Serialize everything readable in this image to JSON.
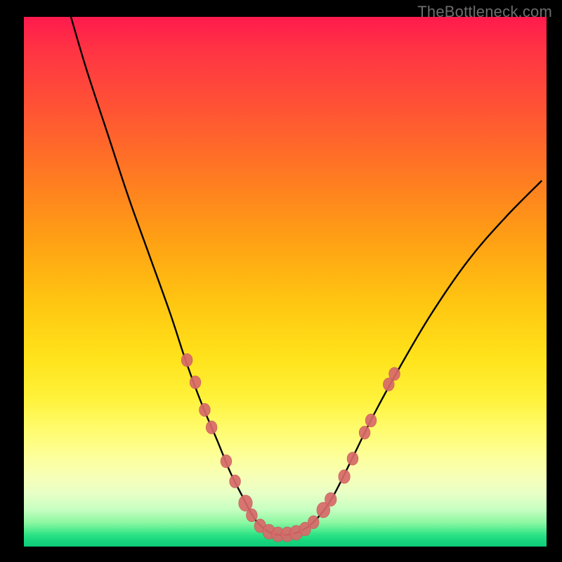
{
  "watermark": "TheBottleneck.com",
  "colors": {
    "frame": "#000000",
    "curve": "#000000",
    "marker_fill": "#d86a6a",
    "marker_stroke": "#c85a5a"
  },
  "chart_data": {
    "type": "line",
    "title": "",
    "xlabel": "",
    "ylabel": "",
    "xlim": [
      0,
      100
    ],
    "ylim": [
      0,
      100
    ],
    "grid": false,
    "legend": false,
    "note": "Bottleneck-style V curve. Axes are unlabeled; values are estimated positions in percent of plot area (0,0 = bottom-left).",
    "series": [
      {
        "name": "bottleneck-curve",
        "x": [
          9,
          12,
          16,
          20,
          24,
          28,
          31,
          34,
          37,
          39.5,
          41.8,
          43.5,
          45,
          47,
          49,
          51,
          53.5,
          56,
          58.5,
          60.5,
          63,
          67,
          72,
          78,
          85,
          92,
          99
        ],
        "y": [
          100,
          90,
          78,
          66,
          55,
          44,
          35,
          27,
          20,
          14,
          9.5,
          6.3,
          4.2,
          2.7,
          2.2,
          2.3,
          3.2,
          5.2,
          8.4,
          12,
          17,
          25,
          34,
          44,
          54,
          62,
          69
        ]
      }
    ],
    "markers": [
      {
        "x": 31.2,
        "y": 35.2,
        "r": 1.05
      },
      {
        "x": 32.8,
        "y": 31.0,
        "r": 1.05
      },
      {
        "x": 34.6,
        "y": 25.8,
        "r": 1.05
      },
      {
        "x": 35.9,
        "y": 22.5,
        "r": 1.05
      },
      {
        "x": 38.7,
        "y": 16.1,
        "r": 1.05
      },
      {
        "x": 40.4,
        "y": 12.3,
        "r": 1.05
      },
      {
        "x": 42.4,
        "y": 8.2,
        "r": 1.3
      },
      {
        "x": 43.6,
        "y": 5.9,
        "r": 1.05
      },
      {
        "x": 45.2,
        "y": 3.9,
        "r": 1.1
      },
      {
        "x": 46.9,
        "y": 2.8,
        "r": 1.2
      },
      {
        "x": 48.6,
        "y": 2.3,
        "r": 1.2
      },
      {
        "x": 50.4,
        "y": 2.3,
        "r": 1.2
      },
      {
        "x": 52.1,
        "y": 2.6,
        "r": 1.2
      },
      {
        "x": 53.8,
        "y": 3.3,
        "r": 1.1
      },
      {
        "x": 55.4,
        "y": 4.6,
        "r": 1.05
      },
      {
        "x": 57.3,
        "y": 6.9,
        "r": 1.25
      },
      {
        "x": 58.7,
        "y": 8.9,
        "r": 1.1
      },
      {
        "x": 61.3,
        "y": 13.2,
        "r": 1.1
      },
      {
        "x": 62.9,
        "y": 16.6,
        "r": 1.05
      },
      {
        "x": 65.2,
        "y": 21.5,
        "r": 1.05
      },
      {
        "x": 66.4,
        "y": 23.8,
        "r": 1.05
      },
      {
        "x": 69.8,
        "y": 30.6,
        "r": 1.05
      },
      {
        "x": 70.9,
        "y": 32.6,
        "r": 1.05
      }
    ]
  }
}
